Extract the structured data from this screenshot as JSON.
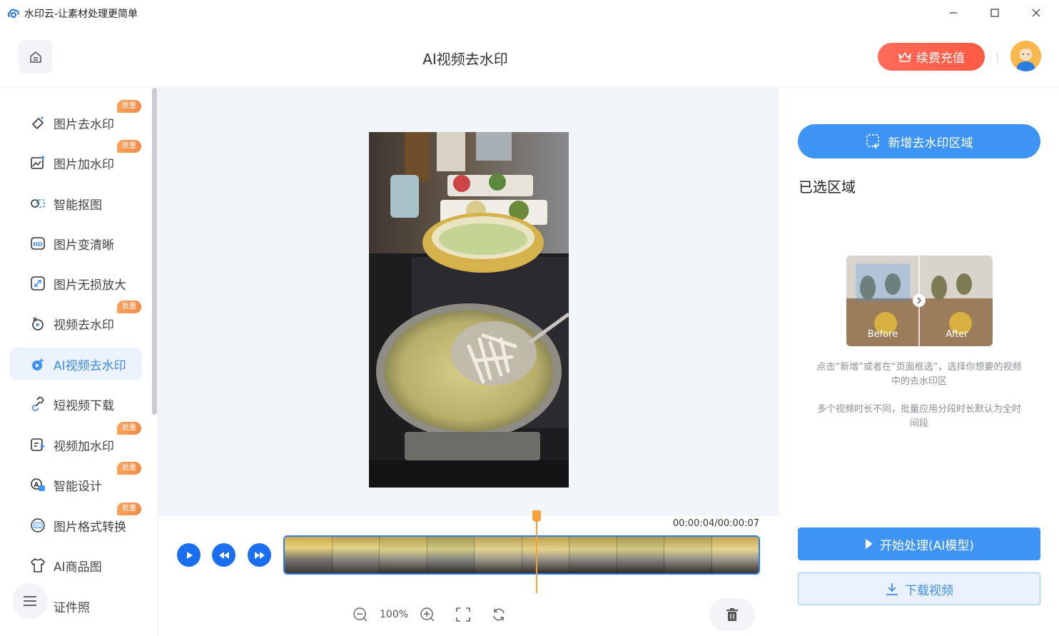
{
  "window": {
    "title": "水印云-让素材处理更简单",
    "controls": [
      "minimize-icon",
      "maximize-icon",
      "close-icon"
    ]
  },
  "header": {
    "title": "AI视频去水印",
    "renew_label": "续费充值",
    "home_icon": "home-icon",
    "crown_icon": "crown-icon"
  },
  "sidebar": {
    "badge": "批量",
    "items": [
      {
        "label": "图片去水印",
        "icon": "eraser-icon",
        "batch": true
      },
      {
        "label": "图片加水印",
        "icon": "image-add-icon",
        "batch": true
      },
      {
        "label": "智能抠图",
        "icon": "cutout-icon",
        "batch": false
      },
      {
        "label": "图片变清晰",
        "icon": "hd-icon",
        "batch": false
      },
      {
        "label": "图片无损放大",
        "icon": "enlarge-icon",
        "batch": false
      },
      {
        "label": "视频去水印",
        "icon": "video-erase-icon",
        "batch": true
      },
      {
        "label": "AI视频去水印",
        "icon": "ai-video-icon",
        "batch": false,
        "active": true
      },
      {
        "label": "短视频下载",
        "icon": "link-icon",
        "batch": false
      },
      {
        "label": "视频加水印",
        "icon": "video-add-icon",
        "batch": true
      },
      {
        "label": "智能设计",
        "icon": "design-icon",
        "batch": true
      },
      {
        "label": "图片格式转换",
        "icon": "jpg-icon",
        "batch": true
      },
      {
        "label": "AI商品图",
        "icon": "tshirt-icon",
        "batch": false
      },
      {
        "label": "证件照",
        "icon": "id-photo-icon",
        "batch": false
      }
    ]
  },
  "timeline": {
    "time": "00:00:04/00:00:07",
    "zoom": "100%",
    "playhead_fraction": 0.535
  },
  "right_panel": {
    "add_area_label": "新增去水印区域",
    "selected_title": "已选区域",
    "demo_before": "Before",
    "demo_after": "After",
    "hint1": "点击“新增”或者在“页面框选”，选择你想要的视频中的去水印区",
    "hint2": "多个视频时长不同，批量应用分段时长默认为全时间段",
    "start_label": "开始处理(AI模型)",
    "download_label": "下载视频"
  },
  "colors": {
    "accent": "#3d94f5",
    "play_blue": "#1a6fef",
    "renew_red": "#ff5a44",
    "badge_orange": "#f28b4a",
    "playhead": "#f5a23a",
    "canvas_bg": "#f2f5fa"
  }
}
